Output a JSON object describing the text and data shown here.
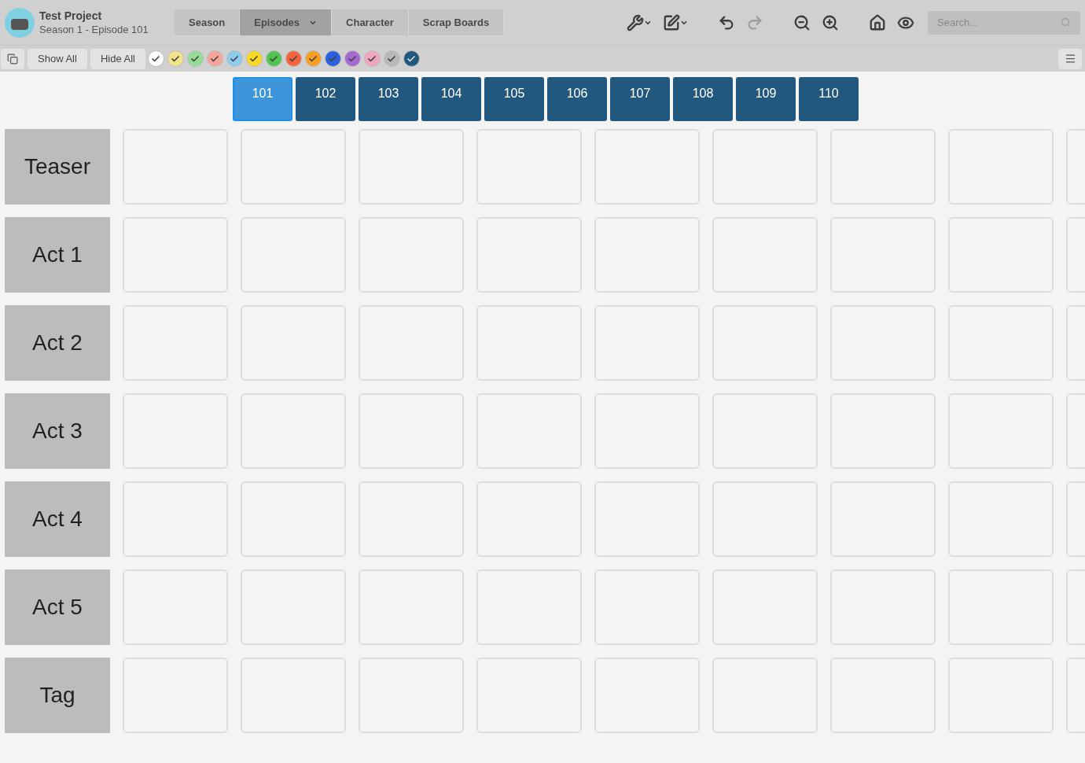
{
  "project": {
    "title": "Test Project",
    "subtitle": "Season 1 - Episode 101"
  },
  "tabs": [
    {
      "label": "Season",
      "selected": false,
      "dropdown": false
    },
    {
      "label": "Episodes",
      "selected": true,
      "dropdown": true
    },
    {
      "label": "Character",
      "selected": false,
      "dropdown": false
    },
    {
      "label": "Scrap Boards",
      "selected": false,
      "dropdown": false
    }
  ],
  "toolbar": [
    {
      "kind": "wrench",
      "disabled": false
    },
    {
      "kind": "edit",
      "disabled": false
    },
    {
      "kind": "undo",
      "disabled": false
    },
    {
      "kind": "redo",
      "disabled": true
    },
    {
      "kind": "zoom-out",
      "disabled": false
    },
    {
      "kind": "zoom-in",
      "disabled": false
    },
    {
      "kind": "home",
      "disabled": false
    },
    {
      "kind": "eye",
      "disabled": false
    }
  ],
  "search": {
    "placeholder": "Search..."
  },
  "filter_buttons": [
    "Show All",
    "Hide All"
  ],
  "color_filters": [
    {
      "color": "#ffffff",
      "checked": true
    },
    {
      "color": "#f3e38c",
      "checked": true
    },
    {
      "color": "#94dc96",
      "checked": true
    },
    {
      "color": "#f5a597",
      "checked": true
    },
    {
      "color": "#8ccbeb",
      "checked": true
    },
    {
      "color": "#fbd922",
      "checked": true
    },
    {
      "color": "#50c350",
      "checked": true
    },
    {
      "color": "#f5643f",
      "checked": true
    },
    {
      "color": "#f89e24",
      "checked": true
    },
    {
      "color": "#2a5fdf",
      "checked": true
    },
    {
      "color": "#a46ad0",
      "checked": true
    },
    {
      "color": "#f0a6bd",
      "checked": true
    },
    {
      "color": "#b8b8b8",
      "checked": true
    },
    {
      "color": "#21587e",
      "checked": true
    }
  ],
  "episodes": [
    {
      "label": "101",
      "selected": true
    },
    {
      "label": "102",
      "selected": false
    },
    {
      "label": "103",
      "selected": false
    },
    {
      "label": "104",
      "selected": false
    },
    {
      "label": "105",
      "selected": false
    },
    {
      "label": "106",
      "selected": false
    },
    {
      "label": "107",
      "selected": false
    },
    {
      "label": "108",
      "selected": false
    },
    {
      "label": "109",
      "selected": false
    },
    {
      "label": "110",
      "selected": false
    }
  ],
  "acts": [
    "Teaser",
    "Act 1",
    "Act 2",
    "Act 3",
    "Act 4",
    "Act 5",
    "Tag"
  ]
}
